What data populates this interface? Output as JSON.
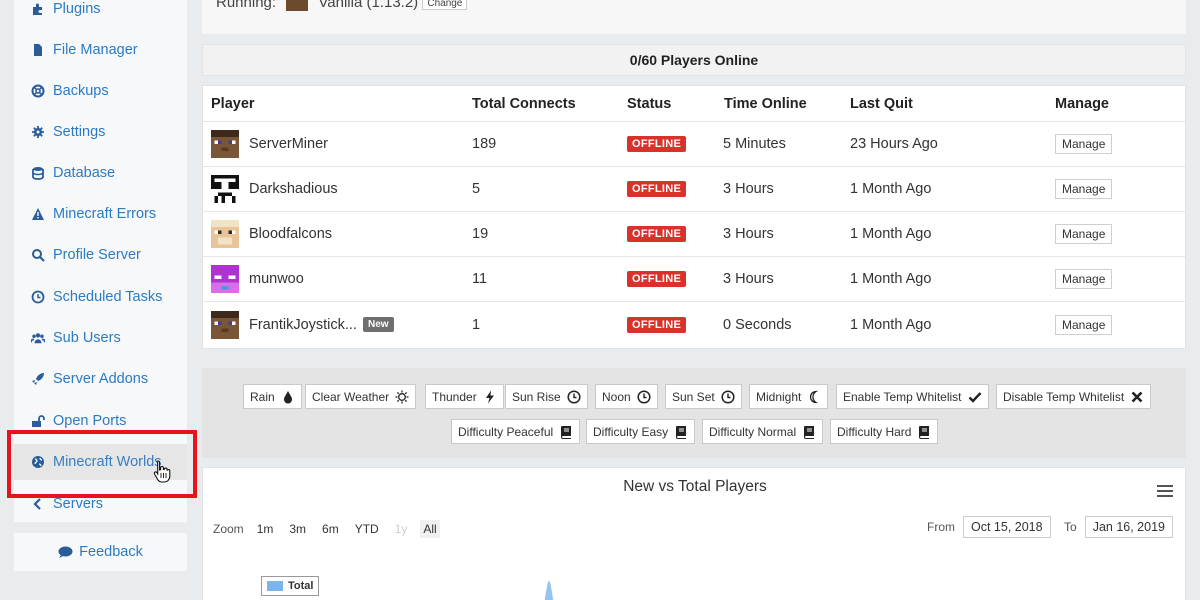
{
  "sidebar": {
    "items": [
      {
        "label": "Plugins",
        "icon": "puzzle-icon"
      },
      {
        "label": "File Manager",
        "icon": "file-icon"
      },
      {
        "label": "Backups",
        "icon": "life-ring-icon"
      },
      {
        "label": "Settings",
        "icon": "gear-icon"
      },
      {
        "label": "Database",
        "icon": "database-icon"
      },
      {
        "label": "Minecraft Errors",
        "icon": "warning-icon"
      },
      {
        "label": "Profile Server",
        "icon": "search-icon"
      },
      {
        "label": "Scheduled Tasks",
        "icon": "clock-icon"
      },
      {
        "label": "Sub Users",
        "icon": "users-icon"
      },
      {
        "label": "Server Addons",
        "icon": "rocket-icon"
      },
      {
        "label": "Open Ports",
        "icon": "unlock-icon"
      },
      {
        "label": "Minecraft Worlds",
        "icon": "globe-icon"
      },
      {
        "label": "Servers",
        "icon": "chevron-left-icon"
      }
    ],
    "feedback_label": "Feedback"
  },
  "top": {
    "running_label": "Running:",
    "version": "Vanilla (1.13.2)",
    "change_label": "Change"
  },
  "players_panel": {
    "title": "0/60 Players Online",
    "columns": [
      "Player",
      "Total Connects",
      "Status",
      "Time Online",
      "Last Quit",
      "Manage"
    ],
    "rows": [
      {
        "name": "ServerMiner",
        "connects": "189",
        "status": "OFFLINE",
        "time_online": "5 Minutes",
        "last_quit": "23 Hours Ago",
        "manage": "Manage",
        "new": ""
      },
      {
        "name": "Darkshadious",
        "connects": "5",
        "status": "OFFLINE",
        "time_online": "3 Hours",
        "last_quit": "1 Month Ago",
        "manage": "Manage",
        "new": ""
      },
      {
        "name": "Bloodfalcons",
        "connects": "19",
        "status": "OFFLINE",
        "time_online": "3 Hours",
        "last_quit": "1 Month Ago",
        "manage": "Manage",
        "new": ""
      },
      {
        "name": "munwoo",
        "connects": "11",
        "status": "OFFLINE",
        "time_online": "3 Hours",
        "last_quit": "1 Month Ago",
        "manage": "Manage",
        "new": ""
      },
      {
        "name": "FrantikJoystick...",
        "connects": "1",
        "status": "OFFLINE",
        "time_online": "0 Seconds",
        "last_quit": "1 Month Ago",
        "manage": "Manage",
        "new": "New"
      }
    ]
  },
  "commands": {
    "row1": [
      {
        "label": "Rain",
        "icon": "drop-icon"
      },
      {
        "label": "Clear Weather",
        "icon": "sun-icon"
      },
      {
        "label": "Thunder",
        "icon": "bolt-icon"
      },
      {
        "label": "Sun Rise",
        "icon": "clock-icon"
      },
      {
        "label": "Noon",
        "icon": "clock-icon"
      },
      {
        "label": "Sun Set",
        "icon": "clock-icon"
      },
      {
        "label": "Midnight",
        "icon": "moon-icon"
      },
      {
        "label": "Enable Temp Whitelist",
        "icon": "check-icon"
      },
      {
        "label": "Disable Temp Whitelist",
        "icon": "x-icon"
      }
    ],
    "row2": [
      {
        "label": "Difficulty Peaceful",
        "icon": "book-icon"
      },
      {
        "label": "Difficulty Easy",
        "icon": "book-icon"
      },
      {
        "label": "Difficulty Normal",
        "icon": "book-icon"
      },
      {
        "label": "Difficulty Hard",
        "icon": "book-icon"
      }
    ]
  },
  "chart": {
    "title": "New vs Total Players",
    "zoom_label": "Zoom",
    "zoom_options": [
      "1m",
      "3m",
      "6m",
      "YTD",
      "1y",
      "All"
    ],
    "from_label": "From",
    "from_value": "Oct 15, 2018",
    "to_label": "To",
    "to_value": "Jan 16, 2019",
    "legend_total": "Total",
    "series_color": "#7cb5ec"
  }
}
